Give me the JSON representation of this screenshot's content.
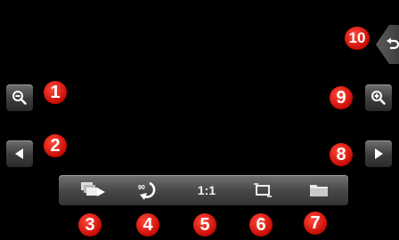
{
  "colors": {
    "background": "#000000",
    "badge": "#d9140a",
    "button": "#4a4a4a"
  },
  "controls": {
    "zoom_out": {
      "icon": "zoom-out-icon"
    },
    "previous": {
      "icon": "arrow-left-icon"
    },
    "zoom_in": {
      "icon": "zoom-in-icon"
    },
    "next": {
      "icon": "arrow-right-icon"
    },
    "back": {
      "icon": "return-icon"
    }
  },
  "toolbar": {
    "slideshow": {
      "icon": "slideshow-icon"
    },
    "rotate": {
      "icon": "rotate-icon",
      "label": "90"
    },
    "actual_size": {
      "label": "1:1"
    },
    "fit_screen": {
      "icon": "fit-screen-icon"
    },
    "open_folder": {
      "icon": "folder-icon"
    }
  },
  "badges": [
    "1",
    "2",
    "3",
    "4",
    "5",
    "6",
    "7",
    "8",
    "9",
    "10"
  ]
}
